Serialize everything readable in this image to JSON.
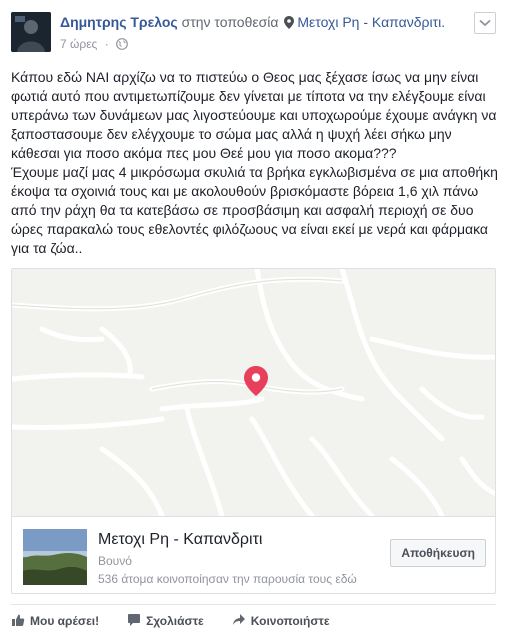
{
  "post": {
    "author": "Δημητρης Τρελος",
    "at_location_text": "στην τοποθεσία",
    "location": "Μετοχι Ρη - Καπανδριτι.",
    "time": "7 ώρες",
    "separator": "·",
    "privacy_icon": "globe-icon",
    "text": "Κάπου εδώ ΝΑΙ αρχίζω να το πιστεύω ο Θεος μας ξέχασε ίσως να μην είναι φωτιά αυτό που αντιμετωπίζουμε δεν γίνεται με τίποτα να την ελέγξουμε είναι υπεράνω των δυνάμεων μας λιγοστεύουμε και υποχωρούμε έχουμε ανάγκη να ξαποστασουμε δεν ελέγχουμε το σώμα μας αλλά η ψυχή λέει σήκω μην κάθεσαι για ποσο ακόμα πες μου Θεέ μου για ποσο ακομα???\nΈχουμε μαζί μας 4 μικρόσωμα σκυλιά τα βρήκα εγκλωβισμένα σε μια αποθήκη έκοψα τα σχοινιά τους και με ακολουθούν βρισκόμαστε βόρεια 1,6 χιλ πάνω από την ράχη θα τα κατεβάσω σε προσβάσιμη και ασφαλή περιοχή σε δυο ώρες παρακαλώ τους εθελοντές φιλόζωους να είναι εκεί με νερά και φάρμακα για τα ζώα.."
  },
  "place": {
    "name": "Μετοχι Ρη - Καπανδριτι",
    "category": "Βουνό",
    "checkins": "536 άτομα κοινοποίησαν την παρουσία τους εδώ",
    "save_label": "Αποθήκευση"
  },
  "actions": {
    "like": "Μου αρέσει!",
    "comment": "Σχολιάστε",
    "share": "Κοινοποιήστε"
  },
  "colors": {
    "link": "#365899",
    "pin": "#e8405a",
    "meta": "#90949c"
  }
}
